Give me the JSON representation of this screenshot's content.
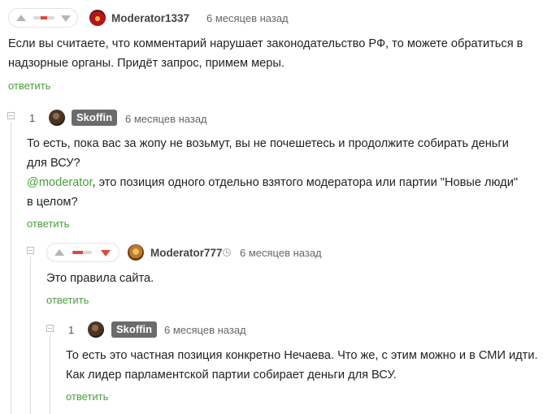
{
  "comments": [
    {
      "id": "c1",
      "username": "Moderator1337",
      "time": "6 месяцев назад",
      "text_lines": [
        "Если вы считаете, что комментарий нарушает законодательство РФ, то можете обратиться в",
        "надзорные органы. Придёт запрос, примем меры."
      ],
      "reply_label": "ответить",
      "vote_fraction_negative": 0.3
    },
    {
      "id": "c2",
      "rating": "1",
      "username": "Skoffin",
      "time": "6 месяцев назад",
      "text_lines": [
        "То есть, пока вас за жопу не возьмут, вы не почешетесь и продолжите собирать деньги",
        "для ВСУ?"
      ],
      "mention": "@moderator",
      "mention_rest": ", это позиция одного отдельно взятого модератора или партии \"Новые люди\"",
      "text_line_last": "в целом?",
      "reply_label": "ответить"
    },
    {
      "id": "c3",
      "username": "Moderator777",
      "time": "6 месяцев назад",
      "text_lines": [
        "Это правила сайта."
      ],
      "reply_label": "ответить",
      "vote_fraction_negative": 0.55
    },
    {
      "id": "c4",
      "rating": "1",
      "username": "Skoffin",
      "time": "6 месяцев назад",
      "text_lines": [
        "То есть это частная позиция конкретно Нечаева. Что же, с этим можно и в СМИ идти.",
        "Как лидер парламентской партии собирает деньги для ВСУ."
      ],
      "reply_label": "ответить"
    }
  ],
  "colors": {
    "accent_green": "#4a9e3d",
    "downvote_red": "#e0473d",
    "badge_gray": "#6b6b6b"
  }
}
